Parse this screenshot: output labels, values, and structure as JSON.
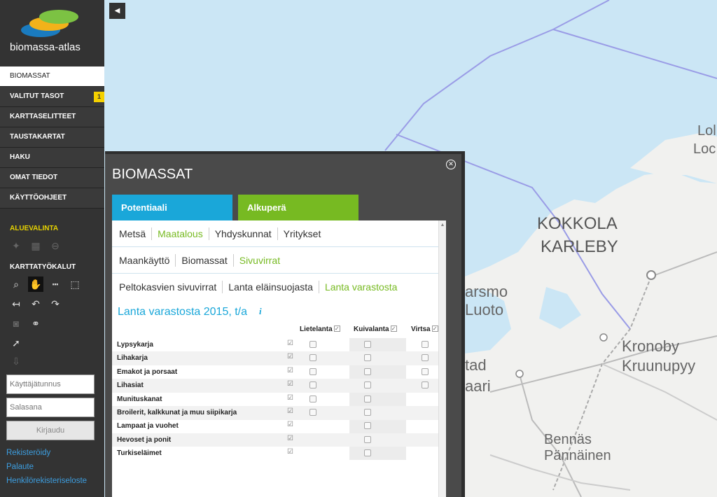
{
  "app": {
    "brand": "biomassa-atlas"
  },
  "nav": [
    {
      "label": "BIOMASSAT",
      "active": true
    },
    {
      "label": "VALITUT TASOT",
      "badge": "1"
    },
    {
      "label": "KARTTASELITTEET"
    },
    {
      "label": "TAUSTAKARTAT"
    },
    {
      "label": "HAKU"
    },
    {
      "label": "OMAT TIEDOT"
    },
    {
      "label": "KÄYTTÖOHJEET"
    }
  ],
  "sidebar": {
    "area_title": "ALUEVALINTA",
    "tools_title": "KARTTATYÖKALUT",
    "username_placeholder": "Käyttäjätunnus",
    "password_placeholder": "Salasana",
    "login_label": "Kirjaudu",
    "links": [
      "Rekisteröidy",
      "Palaute",
      "Henkilörekisteriseloste"
    ]
  },
  "panel": {
    "title": "BIOMASSAT",
    "close_icon": "close-icon",
    "tabs": [
      {
        "label": "Potentiaali",
        "color": "#1aa7d9"
      },
      {
        "label": "Alkuperä",
        "color": "#77ba22"
      }
    ],
    "subtabs1": [
      "Metsä",
      "Maatalous",
      "Yhdyskunnat",
      "Yritykset"
    ],
    "subtabs2": [
      "Maankäyttö",
      "Biomassat",
      "Sivuvirrat"
    ],
    "subtabs3": [
      "Peltokasvien sivuvirrat",
      "Lanta eläinsuojasta",
      "Lanta varastosta"
    ],
    "heading": "Lanta varastosta 2015, t/a",
    "columns": [
      "Lietelanta",
      "Kuivalanta",
      "Virtsa"
    ],
    "rows": [
      {
        "label": "Lypsykarja",
        "liete": true,
        "kuiva": true,
        "virtsa": true
      },
      {
        "label": "Lihakarja",
        "liete": true,
        "kuiva": true,
        "virtsa": true
      },
      {
        "label": "Emakot ja porsaat",
        "liete": true,
        "kuiva": true,
        "virtsa": true
      },
      {
        "label": "Lihasiat",
        "liete": true,
        "kuiva": true,
        "virtsa": true
      },
      {
        "label": "Munituskanat",
        "liete": true,
        "kuiva": true,
        "virtsa": false
      },
      {
        "label": "Broilerit, kalkkunat ja muu siipikarja",
        "liete": true,
        "kuiva": true,
        "virtsa": false
      },
      {
        "label": "Lampaat ja vuohet",
        "liete": false,
        "kuiva": true,
        "virtsa": false
      },
      {
        "label": "Hevoset ja ponit",
        "liete": false,
        "kuiva": true,
        "virtsa": false
      },
      {
        "label": "Turkiseläimet",
        "liete": false,
        "kuiva": true,
        "virtsa": false
      }
    ]
  },
  "map": {
    "labels": [
      {
        "text": "KOKKOLA",
        "id": "kokkola"
      },
      {
        "text": "KARLEBY",
        "id": "karleby"
      },
      {
        "text": "Kronoby",
        "id": "kronoby"
      },
      {
        "text": "Kruunupyy",
        "id": "kruunupyy"
      },
      {
        "text": "Bennäs",
        "id": "bennas"
      },
      {
        "text": "Pännäinen",
        "id": "pannainen"
      },
      {
        "text": "Lol",
        "id": "lol"
      },
      {
        "text": "Loc",
        "id": "loc"
      },
      {
        "text": "arsmo",
        "id": "arsmo"
      },
      {
        "text": "Luoto",
        "id": "luoto"
      },
      {
        "text": "tad",
        "id": "tad"
      },
      {
        "text": "aari",
        "id": "aari"
      }
    ]
  }
}
